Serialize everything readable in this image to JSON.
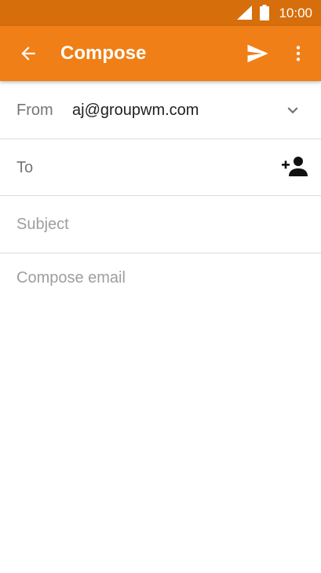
{
  "status_bar": {
    "time": "10:00",
    "signal_icon": "signal-icon",
    "battery_icon": "battery-icon"
  },
  "app_bar": {
    "title": "Compose",
    "back_icon": "arrow-back-icon",
    "send_icon": "send-icon",
    "more_icon": "more-vert-icon"
  },
  "form": {
    "from_label": "From",
    "from_value": "aj@groupwm.com",
    "to_label": "To",
    "to_value": "",
    "subject_placeholder": "Subject",
    "subject_value": "",
    "body_placeholder": "Compose email",
    "body_value": ""
  },
  "colors": {
    "status_bar": "#d66e0b",
    "app_bar": "#ef7f16",
    "label_text": "#757575",
    "placeholder_text": "#9e9e9e",
    "divider": "#dcdcdc"
  }
}
